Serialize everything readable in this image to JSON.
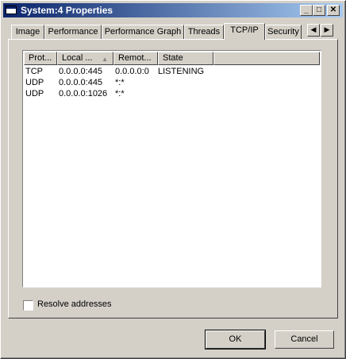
{
  "window": {
    "title": "System:4 Properties",
    "buttons": {
      "minimize": "_",
      "maximize": "□",
      "close": "✕"
    }
  },
  "tabs": [
    {
      "label": "Image",
      "active": false
    },
    {
      "label": "Performance",
      "active": false
    },
    {
      "label": "Performance Graph",
      "active": false
    },
    {
      "label": "Threads",
      "active": false
    },
    {
      "label": "TCP/IP",
      "active": true
    },
    {
      "label": "Security",
      "active": false
    }
  ],
  "tab_scroll": {
    "left": "◀",
    "right": "▶"
  },
  "list": {
    "columns": [
      "Prot...",
      "Local ...",
      "Remot...",
      "State"
    ],
    "sort_indicator": "▲",
    "rows": [
      [
        "TCP",
        "0.0.0.0:445",
        "0.0.0.0:0",
        "LISTENING"
      ],
      [
        "UDP",
        "0.0.0.0:445",
        "*:*",
        ""
      ],
      [
        "UDP",
        "0.0.0.0:1026",
        "*:*",
        ""
      ]
    ]
  },
  "options": {
    "resolve_addresses": "Resolve addresses",
    "resolve_checked": false
  },
  "footer": {
    "ok": "OK",
    "cancel": "Cancel"
  }
}
